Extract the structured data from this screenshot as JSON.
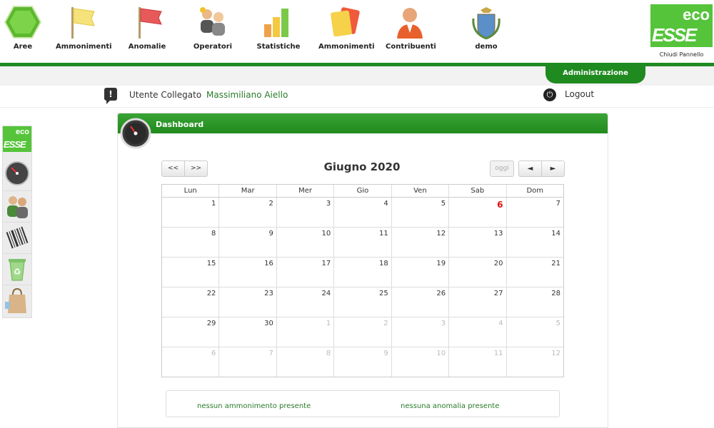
{
  "nav": {
    "items": [
      {
        "label": "Aree",
        "icon": "hexagon-icon"
      },
      {
        "label": "Ammonimenti",
        "icon": "yellow-flag-icon"
      },
      {
        "label": "Anomalie",
        "icon": "red-flag-icon"
      },
      {
        "label": "Operatori",
        "icon": "operators-icon"
      },
      {
        "label": "Statistiche",
        "icon": "bar-chart-icon"
      },
      {
        "label": "Ammonimenti",
        "icon": "cards-icon"
      },
      {
        "label": "Contribuenti",
        "icon": "person-icon"
      },
      {
        "label": "demo",
        "icon": "coat-of-arms-icon"
      }
    ],
    "logo": {
      "top": "eco",
      "bottom": "ESSE"
    },
    "close_panel": "Chiudi Pannello",
    "admin_tab": "Administrazione"
  },
  "user": {
    "label": "Utente Collegato",
    "name": "Massimiliano Aiello",
    "logout": "Logout"
  },
  "sidebar": {
    "logo": {
      "top": "eco",
      "bottom": "ESSE"
    },
    "items": [
      "dashboard-gauge-icon",
      "users-icon",
      "barcode-icon",
      "recycle-bin-icon",
      "shopping-bag-icon"
    ]
  },
  "dashboard": {
    "title": "Dashboard",
    "nav_prev": "<<",
    "nav_next": ">>",
    "month": "Giugno 2020",
    "today_btn": "oggi",
    "arrow_left": "◄",
    "arrow_right": "►",
    "weekdays": [
      "Lun",
      "Mar",
      "Mer",
      "Gio",
      "Ven",
      "Sab",
      "Dom"
    ],
    "weeks": [
      [
        {
          "d": "1"
        },
        {
          "d": "2"
        },
        {
          "d": "3"
        },
        {
          "d": "4"
        },
        {
          "d": "5"
        },
        {
          "d": "6",
          "today": true
        },
        {
          "d": "7"
        }
      ],
      [
        {
          "d": "8"
        },
        {
          "d": "9"
        },
        {
          "d": "10"
        },
        {
          "d": "11"
        },
        {
          "d": "12"
        },
        {
          "d": "13"
        },
        {
          "d": "14"
        }
      ],
      [
        {
          "d": "15"
        },
        {
          "d": "16"
        },
        {
          "d": "17"
        },
        {
          "d": "18"
        },
        {
          "d": "19"
        },
        {
          "d": "20"
        },
        {
          "d": "21"
        }
      ],
      [
        {
          "d": "22"
        },
        {
          "d": "23"
        },
        {
          "d": "24"
        },
        {
          "d": "25"
        },
        {
          "d": "26"
        },
        {
          "d": "27"
        },
        {
          "d": "28"
        }
      ],
      [
        {
          "d": "29"
        },
        {
          "d": "30"
        },
        {
          "d": "1",
          "other": true
        },
        {
          "d": "2",
          "other": true
        },
        {
          "d": "3",
          "other": true
        },
        {
          "d": "4",
          "other": true
        },
        {
          "d": "5",
          "other": true
        }
      ],
      [
        {
          "d": "6",
          "other": true
        },
        {
          "d": "7",
          "other": true
        },
        {
          "d": "8",
          "other": true
        },
        {
          "d": "9",
          "other": true
        },
        {
          "d": "10",
          "other": true
        },
        {
          "d": "11",
          "other": true
        },
        {
          "d": "12",
          "other": true
        }
      ]
    ],
    "notice_left": "nessun ammonimento presente",
    "notice_right": "nessuna anomalia presente"
  },
  "colors": {
    "brand_green": "#1f8a1f",
    "logo_green": "#55c43a",
    "today_red": "#d11111"
  }
}
